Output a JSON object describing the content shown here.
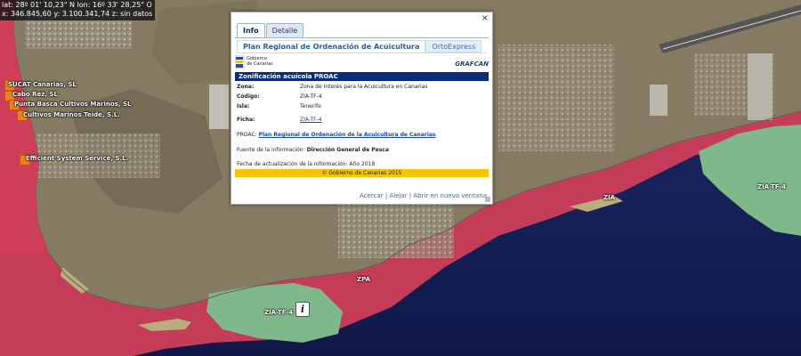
{
  "coords": {
    "line1": "lat: 28º 01' 10,23\" N  lon: 16º 33' 28,25\" O",
    "line2": "x: 346.845,60  y: 3.100.341,74  z: sin datos"
  },
  "map_labels": {
    "zia_left": "ZIA-TF-4",
    "zia_mid": "ZIA",
    "zia_right": "ZIA-TF-4",
    "zpa": "ZPA"
  },
  "farms": [
    "SUCAT Canarias, SL",
    "Cabo Rez, SL",
    "Punta Basca Cultivos Marinos, SL",
    "Cultivos Marinos Teide, S.L.",
    "Efficient System Service, S.L."
  ],
  "popup": {
    "close": "×",
    "tabs": [
      "Info",
      "Detalle"
    ],
    "subtabs": [
      "Plan Regional de Ordenación de Acuicultura",
      "OrtoExpress"
    ],
    "gob_logo_text": "Gobierno de Canarias",
    "grafcan": "GRAFCAN",
    "section_title": "Zonificación acuícola PROAC",
    "fields": [
      {
        "key": "Zona:",
        "value": "Zona de Interés para la Acuicultura en Canarias"
      },
      {
        "key": "Código:",
        "value": "ZIA-TF-4"
      },
      {
        "key": "Isla:",
        "value": "Tenerife"
      },
      {
        "key": "Ficha:",
        "value": "ZIA-TF-4"
      }
    ],
    "proac_label": "PROAC:",
    "proac_link": "Plan Regional de Ordenación de la Acuicultura de Canarias",
    "fuente_label": "Fuente de la información:",
    "fuente_value": "Dirección General de Pesca",
    "fecha_label": "Fecha de actualización de la información:",
    "fecha_value": "Año 2018",
    "footer": "© Gobierno de Canarias 2015",
    "actions": [
      "Acercar",
      "Alejar",
      "Abrir en nueva ventana"
    ],
    "sep": "|"
  },
  "info_pin": "i",
  "colors": {
    "ocean": "#151f5c",
    "zpa": "#cf3e58",
    "zia": "#7fb88a",
    "land": "#8a7d64",
    "header_bar": "#0a2a7a",
    "footer_bar": "#f7c400"
  }
}
